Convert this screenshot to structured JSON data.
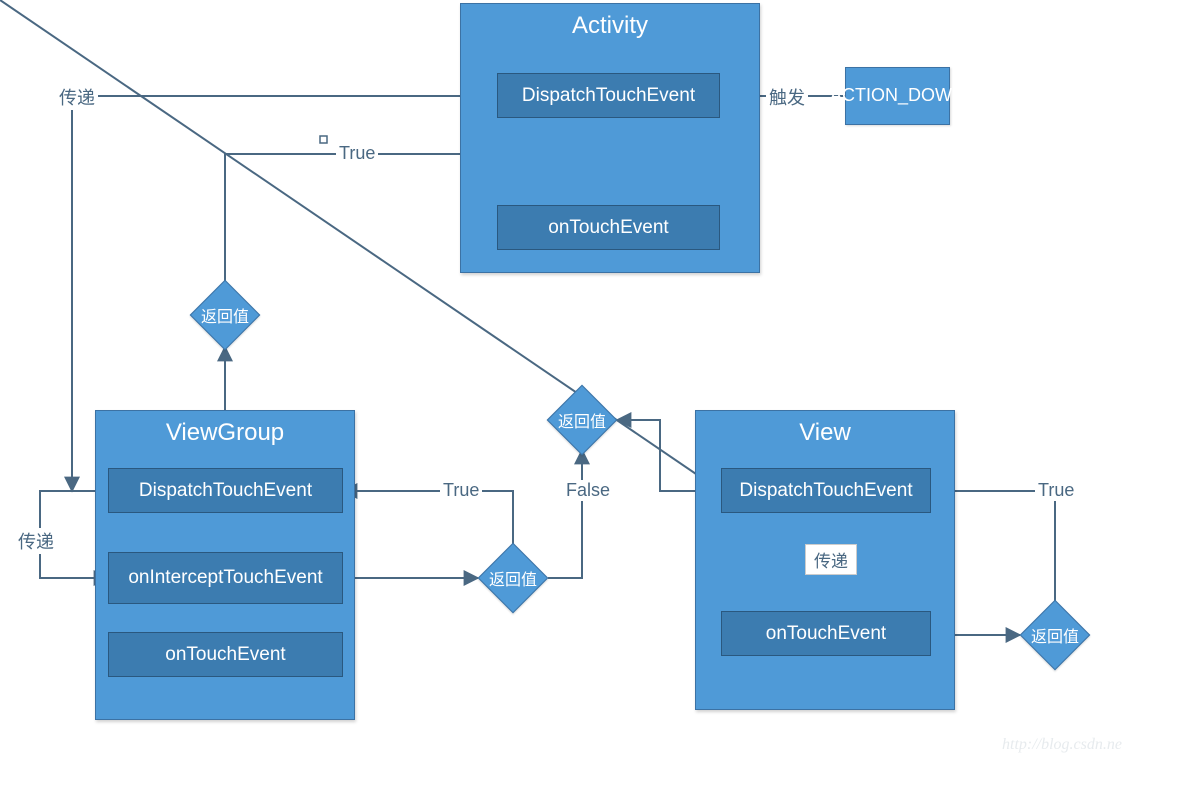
{
  "colors": {
    "container_fill": "#4f9ad7",
    "method_fill": "#3c7cb0",
    "stroke": "#4a6882"
  },
  "activity": {
    "title": "Activity",
    "dispatch": "DispatchTouchEvent",
    "ontouch": "onTouchEvent"
  },
  "viewgroup": {
    "title": "ViewGroup",
    "dispatch": "DispatchTouchEvent",
    "intercept": "onInterceptTouchEvent",
    "ontouch": "onTouchEvent"
  },
  "view": {
    "title": "View",
    "dispatch": "DispatchTouchEvent",
    "ontouch": "onTouchEvent"
  },
  "action_down": "ACTION_DOWN",
  "diamonds": {
    "d1": "返回值",
    "d2": "返回值",
    "d3": "返回值",
    "d4": "返回值"
  },
  "labels": {
    "trigger": "触发",
    "pass_top": "传递",
    "pass_left": "传递",
    "pass_view": "传递",
    "true_1": "True",
    "true_2": "True",
    "true_3": "True",
    "false_1": "False"
  },
  "watermark": "http://blog.csdn.ne"
}
